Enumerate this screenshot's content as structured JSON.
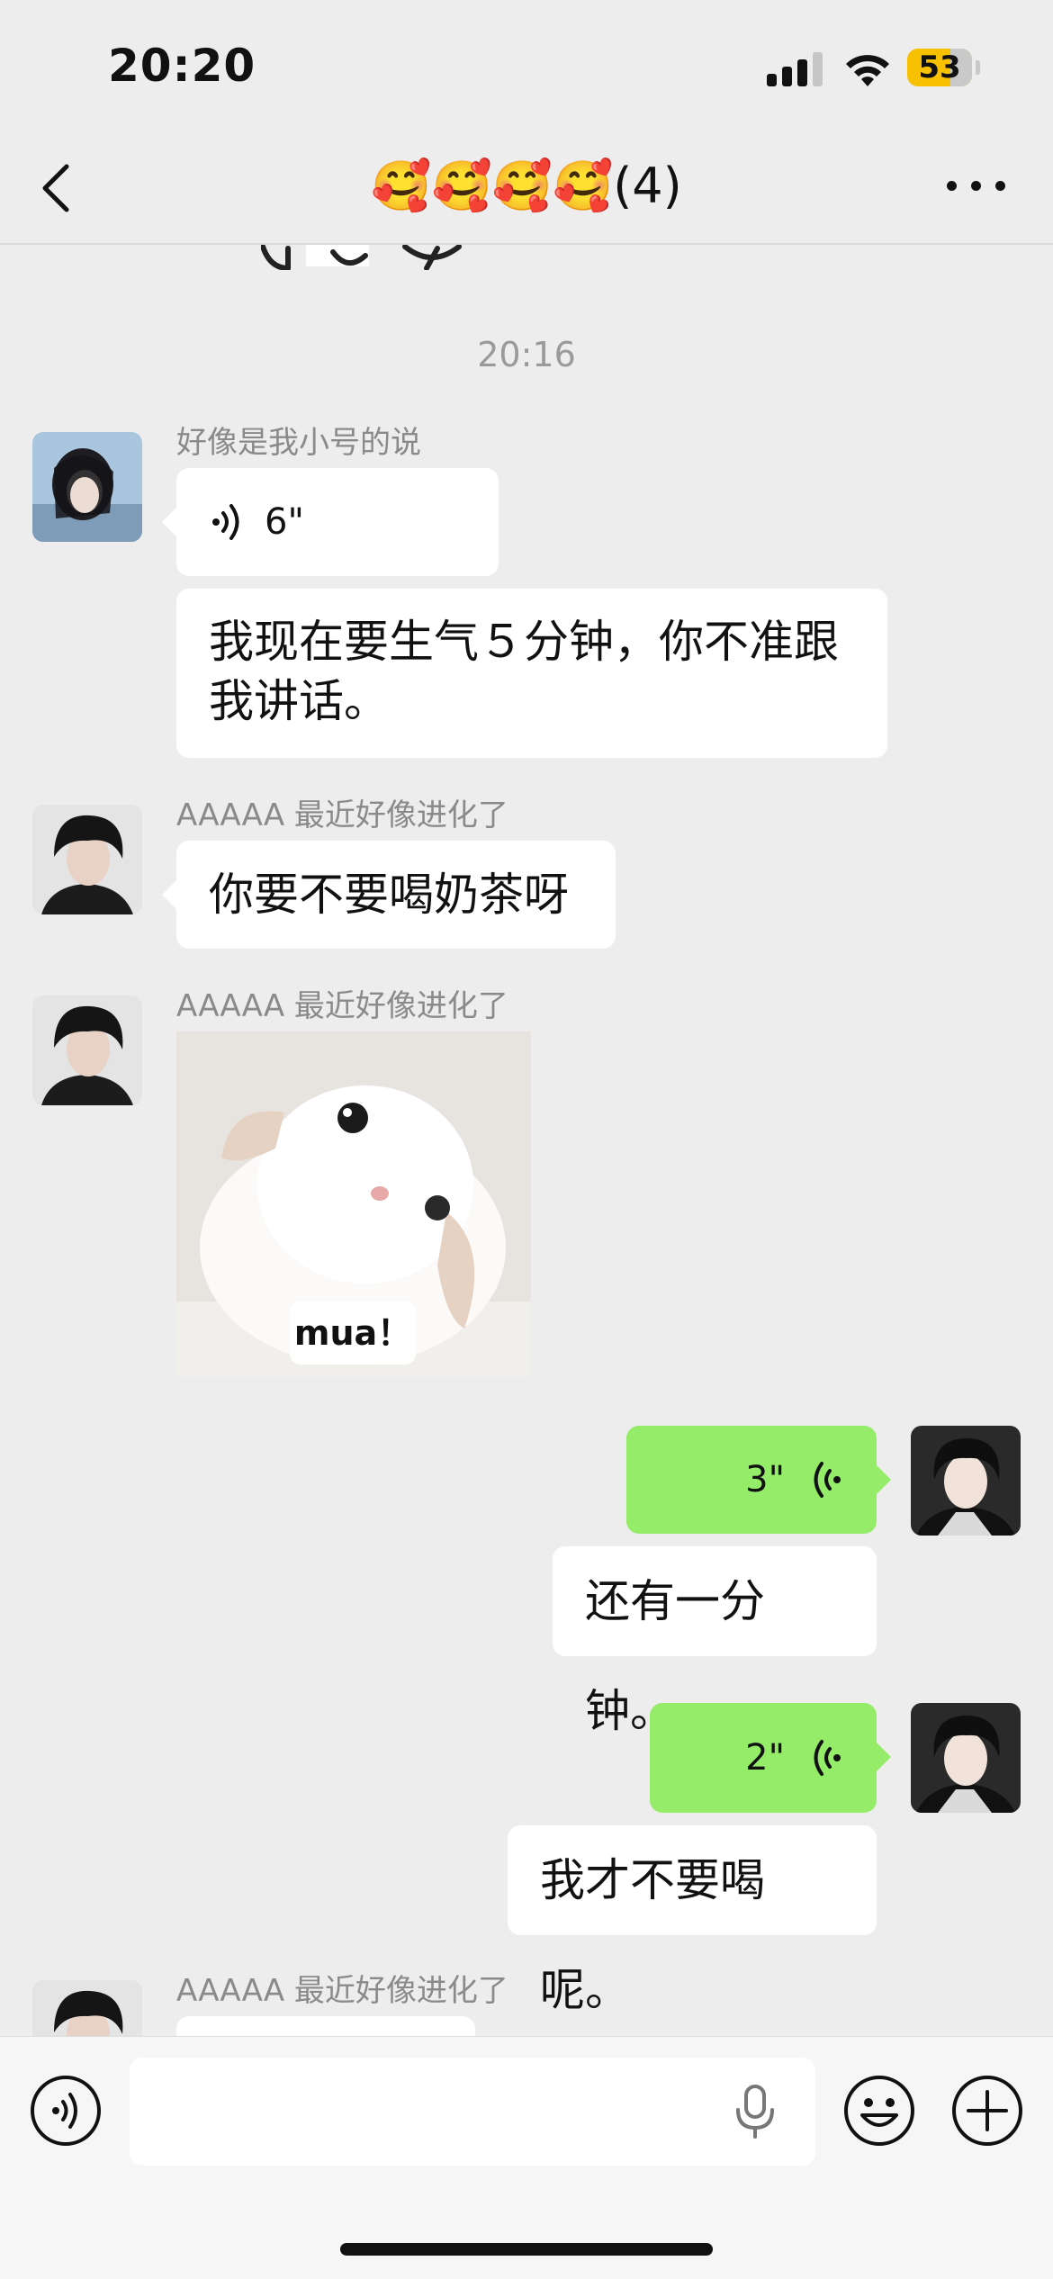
{
  "status_bar": {
    "time": "20:20",
    "battery": "53",
    "icons": [
      "cellular-signal-icon",
      "wifi-icon",
      "battery-icon"
    ]
  },
  "nav": {
    "title": "🥰🥰🥰🥰(4)",
    "back_icon": "chevron-left-icon",
    "more_icon": "more-icon"
  },
  "chat": {
    "timestamp": "20:16",
    "messages": [
      {
        "side": "left",
        "sender": "好像是我小号的说",
        "type": "voice",
        "duration": "6\""
      },
      {
        "side": "left",
        "type": "text",
        "text_lines": [
          "我现在要生气５分钟，你不准跟",
          "我讲话。"
        ]
      },
      {
        "side": "left",
        "sender": "AAAAA 最近好像进化了",
        "type": "text",
        "text": "你要不要喝奶茶呀"
      },
      {
        "side": "left",
        "sender": "AAAAA 最近好像进化了",
        "type": "image",
        "caption": "mua！"
      },
      {
        "side": "right",
        "type": "voice",
        "duration": "3\""
      },
      {
        "side": "right",
        "type": "text",
        "text": "还有一分钟。"
      },
      {
        "side": "right",
        "type": "voice",
        "duration": "2\""
      },
      {
        "side": "right",
        "type": "text",
        "text": "我才不要喝呢。"
      },
      {
        "side": "left",
        "sender": "AAAAA 最近好像进化了",
        "type": "text",
        "text": ""
      }
    ]
  },
  "input_bar": {
    "voice_toggle_icon": "voice-wave-icon",
    "mic_icon": "microphone-icon",
    "emoji_icon": "smiley-icon",
    "plus_icon": "plus-icon",
    "input_value": ""
  },
  "colors": {
    "background": "#EDEDED",
    "bubble_in": "#FFFFFF",
    "bubble_out": "#95EC69",
    "battery": "#F7C000"
  }
}
